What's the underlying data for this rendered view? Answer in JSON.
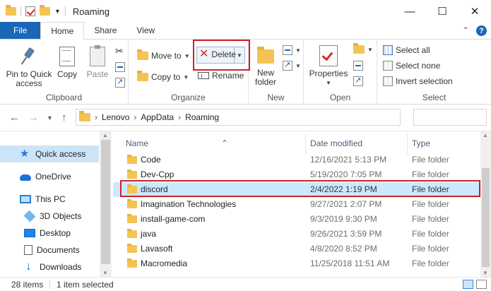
{
  "window": {
    "title": "Roaming",
    "controls": {
      "minimize": "—",
      "maximize": "☐",
      "close": "✕"
    }
  },
  "ribbon_tabs": [
    {
      "label": "File"
    },
    {
      "label": "Home"
    },
    {
      "label": "Share"
    },
    {
      "label": "View"
    }
  ],
  "ribbon_right": {
    "collapse": "⌃",
    "help": "?"
  },
  "ribbon": {
    "clipboard": {
      "label": "Clipboard",
      "pin": "Pin to Quick access",
      "copy": "Copy",
      "paste": "Paste"
    },
    "organize": {
      "label": "Organize",
      "move_to": "Move to",
      "copy_to": "Copy to",
      "delete": "Delete",
      "rename": "Rename"
    },
    "new": {
      "label": "New",
      "new_folder": "New folder"
    },
    "open": {
      "label": "Open",
      "properties": "Properties"
    },
    "select": {
      "label": "Select",
      "select_all": "Select all",
      "select_none": "Select none",
      "invert": "Invert selection"
    }
  },
  "breadcrumb": [
    "Lenovo",
    "AppData",
    "Roaming"
  ],
  "nav_pane": [
    {
      "label": "Quick access",
      "icon": "star-icon",
      "selected": true
    },
    {
      "label": "OneDrive",
      "icon": "cloud-icon"
    },
    {
      "label": "This PC",
      "icon": "pc-icon"
    },
    {
      "label": "3D Objects",
      "icon": "cube-icon"
    },
    {
      "label": "Desktop",
      "icon": "desktop-icon"
    },
    {
      "label": "Documents",
      "icon": "documents-icon"
    },
    {
      "label": "Downloads",
      "icon": "downloads-icon"
    }
  ],
  "columns": {
    "name": "Name",
    "date": "Date modified",
    "type": "Type"
  },
  "files": [
    {
      "name": "Code",
      "date": "12/16/2021 5:13 PM",
      "type": "File folder"
    },
    {
      "name": "Dev-Cpp",
      "date": "5/19/2020 7:05 PM",
      "type": "File folder"
    },
    {
      "name": "discord",
      "date": "2/4/2022 1:19 PM",
      "type": "File folder",
      "selected": true
    },
    {
      "name": "Imagination Technologies",
      "date": "9/27/2021 2:07 PM",
      "type": "File folder"
    },
    {
      "name": "install-game-com",
      "date": "9/3/2019 9:30 PM",
      "type": "File folder"
    },
    {
      "name": "java",
      "date": "9/26/2021 3:59 PM",
      "type": "File folder"
    },
    {
      "name": "Lavasoft",
      "date": "4/8/2020 8:52 PM",
      "type": "File folder"
    },
    {
      "name": "Macromedia",
      "date": "11/25/2018 11:51 AM",
      "type": "File folder"
    }
  ],
  "status": {
    "items": "28 items",
    "selected": "1 item selected"
  },
  "colors": {
    "accent": "#1a66b8",
    "highlight": "#d0202a",
    "selection": "#cce8ff"
  }
}
